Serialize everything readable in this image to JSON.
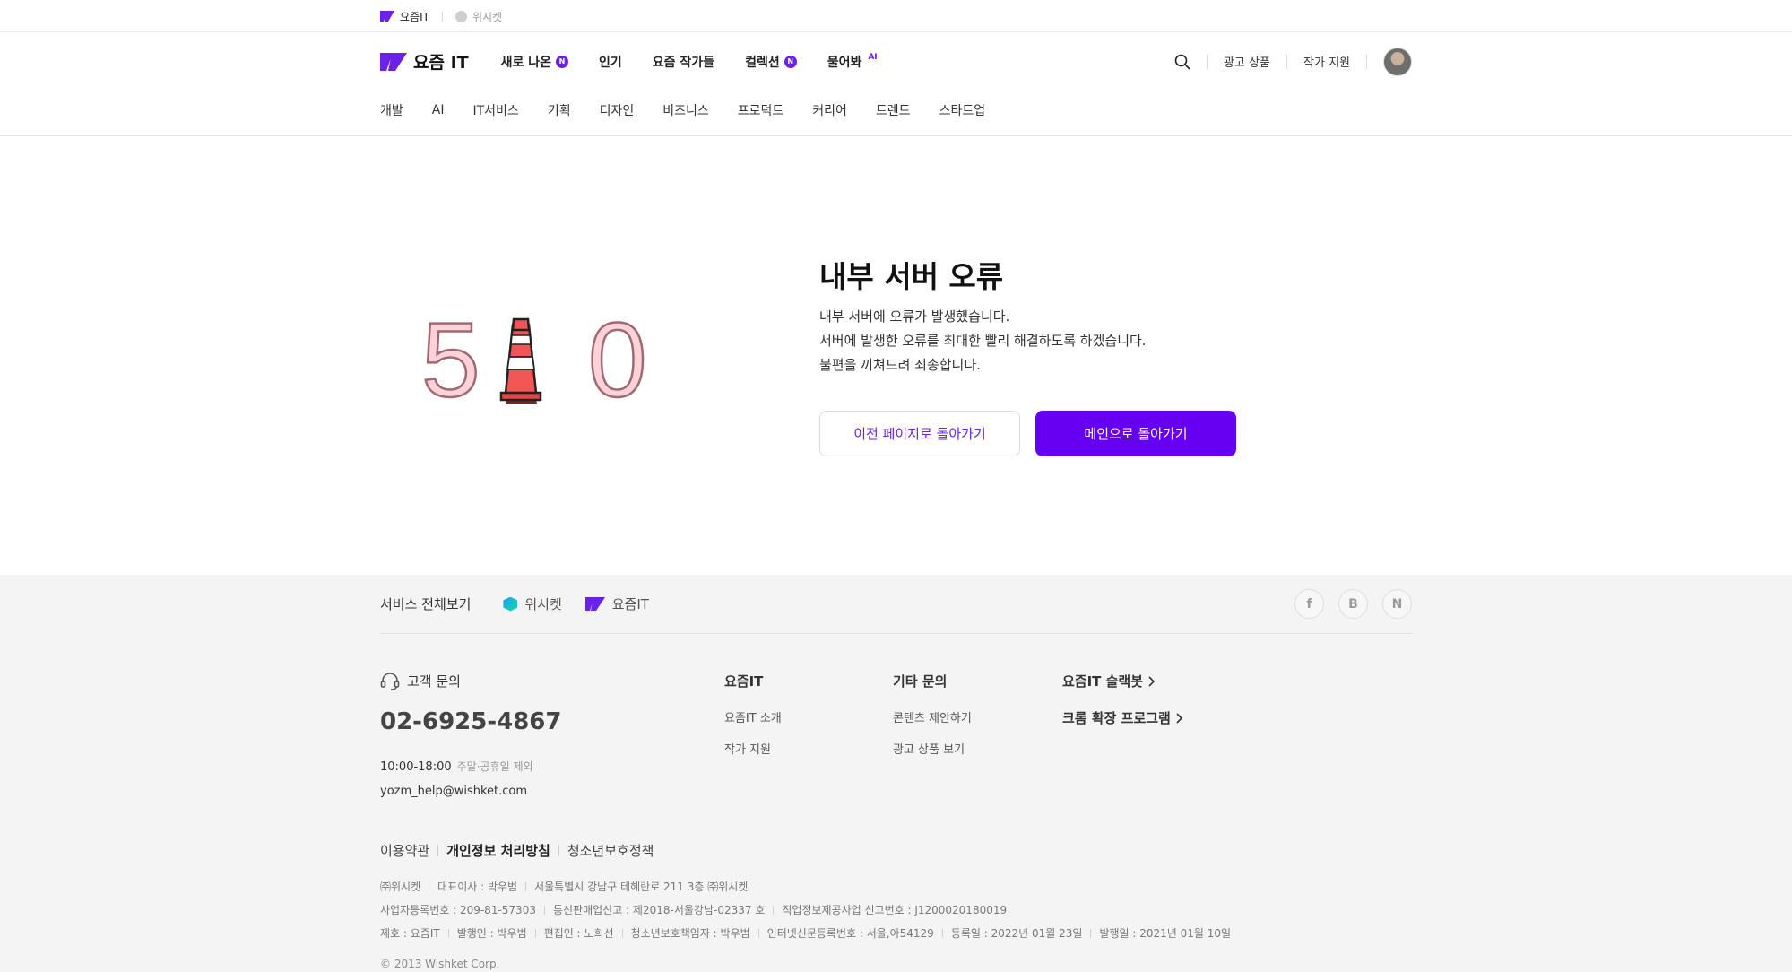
{
  "colors": {
    "brand_purple": "#6500f0",
    "text_dark": "#222222",
    "footer_bg": "#f4f4f4"
  },
  "service_bar": {
    "active": "요즘IT",
    "inactive": "위시켓"
  },
  "header": {
    "brand": "요즘 IT",
    "nav": [
      {
        "label": "새로 나온",
        "badge": "N"
      },
      {
        "label": "인기"
      },
      {
        "label": "요즘 작가들"
      },
      {
        "label": "컬렉션",
        "badge": "N"
      },
      {
        "label": "물어봐",
        "tag": "AI"
      }
    ],
    "ad_link": "광고 상품",
    "writer_link": "작가 지원",
    "icons": {
      "search": "search-icon",
      "avatar": "avatar"
    }
  },
  "categories": [
    "개발",
    "AI",
    "IT서비스",
    "기획",
    "디자인",
    "비즈니스",
    "프로덕트",
    "커리어",
    "트렌드",
    "스타트업"
  ],
  "error": {
    "code_left": "5",
    "code_right": "0",
    "title": "내부 서버 오류",
    "lines": [
      "내부 서버에 오류가 발생했습니다.",
      "서버에 발생한 오류를 최대한 빨리 해결하도록 하겠습니다.",
      "불편을 끼쳐드려 죄송합니다."
    ],
    "btn_prev": "이전 페이지로 돌아가기",
    "btn_main": "메인으로 돌아가기"
  },
  "footer": {
    "all_services": "서비스 전체보기",
    "brands": [
      "위시켓",
      "요즘IT"
    ],
    "socials": [
      "f",
      "B",
      "N"
    ],
    "contact_title": "고객 문의",
    "phone": "02-6925-4867",
    "hours": "10:00-18:00",
    "hours_note": "주말·공휴일 제외",
    "email": "yozm_help@wishket.com",
    "col1": {
      "title": "요즘IT",
      "links": [
        "요즘IT 소개",
        "작가 지원"
      ]
    },
    "col2": {
      "title": "기타 문의",
      "links": [
        "콘텐츠 제안하기",
        "광고 상품 보기"
      ]
    },
    "col3": {
      "links": [
        "요즘IT 슬랙봇",
        "크롬 확장 프로그램"
      ]
    },
    "policies": [
      "이용약관",
      "개인정보 처리방침",
      "청소년보호정책"
    ],
    "info_row1": [
      "㈜위시켓",
      "대표이사 : 박우범",
      "서울특별시 강남구 테헤란로 211 3층 ㈜위시켓"
    ],
    "info_row2": [
      "사업자등록번호 : 209-81-57303",
      "통신판매업신고 : 제2018-서울강남-02337 호",
      "직업정보제공사업 신고번호 : J1200020180019"
    ],
    "info_row3": [
      "제호 : 요즘IT",
      "발행인 : 박우범",
      "편집인 : 노희선",
      "청소년보호책임자 : 박우범",
      "인터넷신문등록번호 : 서울,아54129",
      "등록일 : 2022년 01월 23일",
      "발행일 : 2021년 01월 10일"
    ],
    "copyright": "© 2013 Wishket Corp."
  }
}
